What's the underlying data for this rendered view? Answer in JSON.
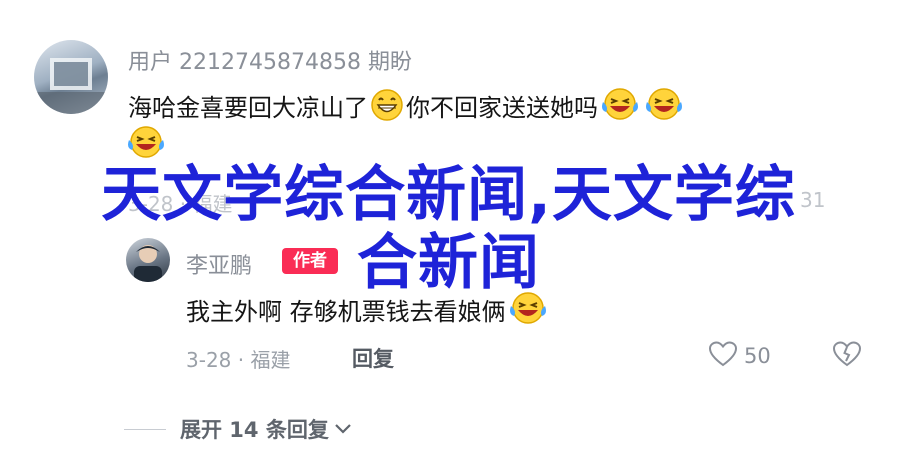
{
  "comment": {
    "username": "用户 2212745874858 期盼",
    "text_part1": "海哈金喜要回大凉山了",
    "text_part2": "你不回家送送她吗",
    "date_location": "3-28 · 福建",
    "reply_label": "回复",
    "like_count": "31",
    "emojis": [
      "grin-emoji",
      "laughing-tears-emoji",
      "laughing-tears-emoji",
      "laughing-tears-emoji"
    ]
  },
  "reply": {
    "username": "李亚鹏",
    "badge": "作者",
    "text": "我主外啊 存够机票钱去看娘俩",
    "date_location": "3-28 · 福建",
    "reply_label": "回复",
    "like_count": "50"
  },
  "expand_label": "展开 14 条回复",
  "overlay": {
    "line1": "天文学综合新闻,天文学综",
    "line2": "合新闻"
  },
  "colors": {
    "overlay_text": "#1e23d8",
    "author_badge": "#fa2c55",
    "muted_text": "#8a8f98"
  }
}
